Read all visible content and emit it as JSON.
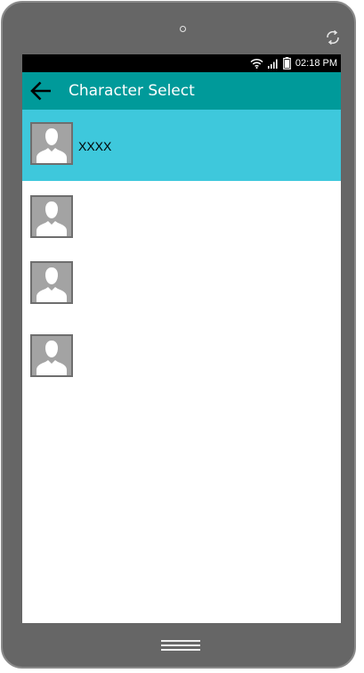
{
  "status_bar": {
    "time": "02:18 PM",
    "icons": [
      "wifi-icon",
      "signal-icon",
      "battery-icon"
    ]
  },
  "app_bar": {
    "back_icon": "arrow-left-icon",
    "title": "Character Select",
    "color": "#009a9a"
  },
  "characters": [
    {
      "name": "XXXX",
      "selected": true
    },
    {
      "name": "",
      "selected": false
    },
    {
      "name": "",
      "selected": false
    },
    {
      "name": "",
      "selected": false
    }
  ],
  "colors": {
    "accent": "#009a9a",
    "selected_row": "#3ec8dc",
    "device_frame": "#666666"
  }
}
